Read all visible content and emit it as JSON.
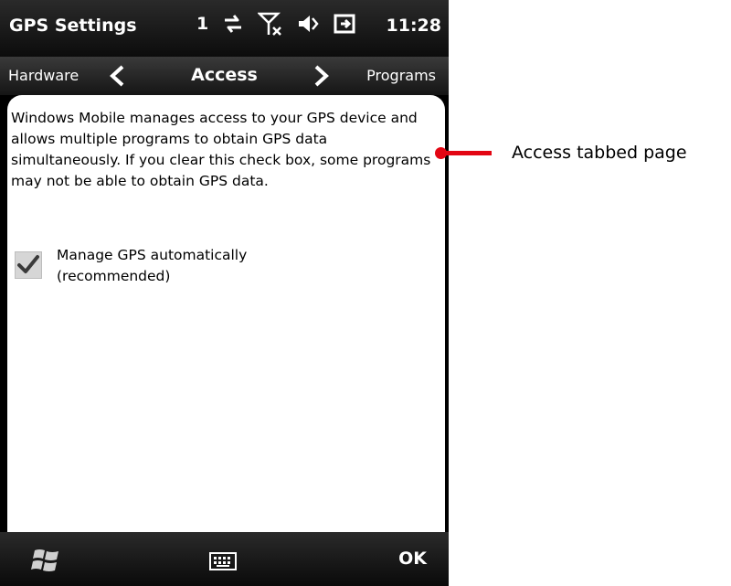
{
  "titlebar": {
    "app_title": "GPS Settings",
    "signal_strength": "1",
    "time": "11:28",
    "icons": [
      "data-transfer-icon",
      "no-signal-icon",
      "speaker-icon",
      "battery-charging-icon"
    ]
  },
  "tabs": {
    "prev": "Hardware",
    "current": "Access",
    "next": "Programs"
  },
  "content": {
    "description": "Windows Mobile manages access to your GPS device and allows multiple programs to obtain GPS data simultaneously. If you clear this check box, some programs may not be able to obtain GPS data.",
    "checkbox_label_line1": "Manage GPS automatically",
    "checkbox_label_line2": "(recommended)",
    "checkbox_checked": true
  },
  "softkeys": {
    "ok_label": "OK",
    "icons": [
      "windows-start-icon",
      "keyboard-icon"
    ]
  },
  "annotation": {
    "label": "Access tabbed page",
    "color": "#e30613"
  }
}
